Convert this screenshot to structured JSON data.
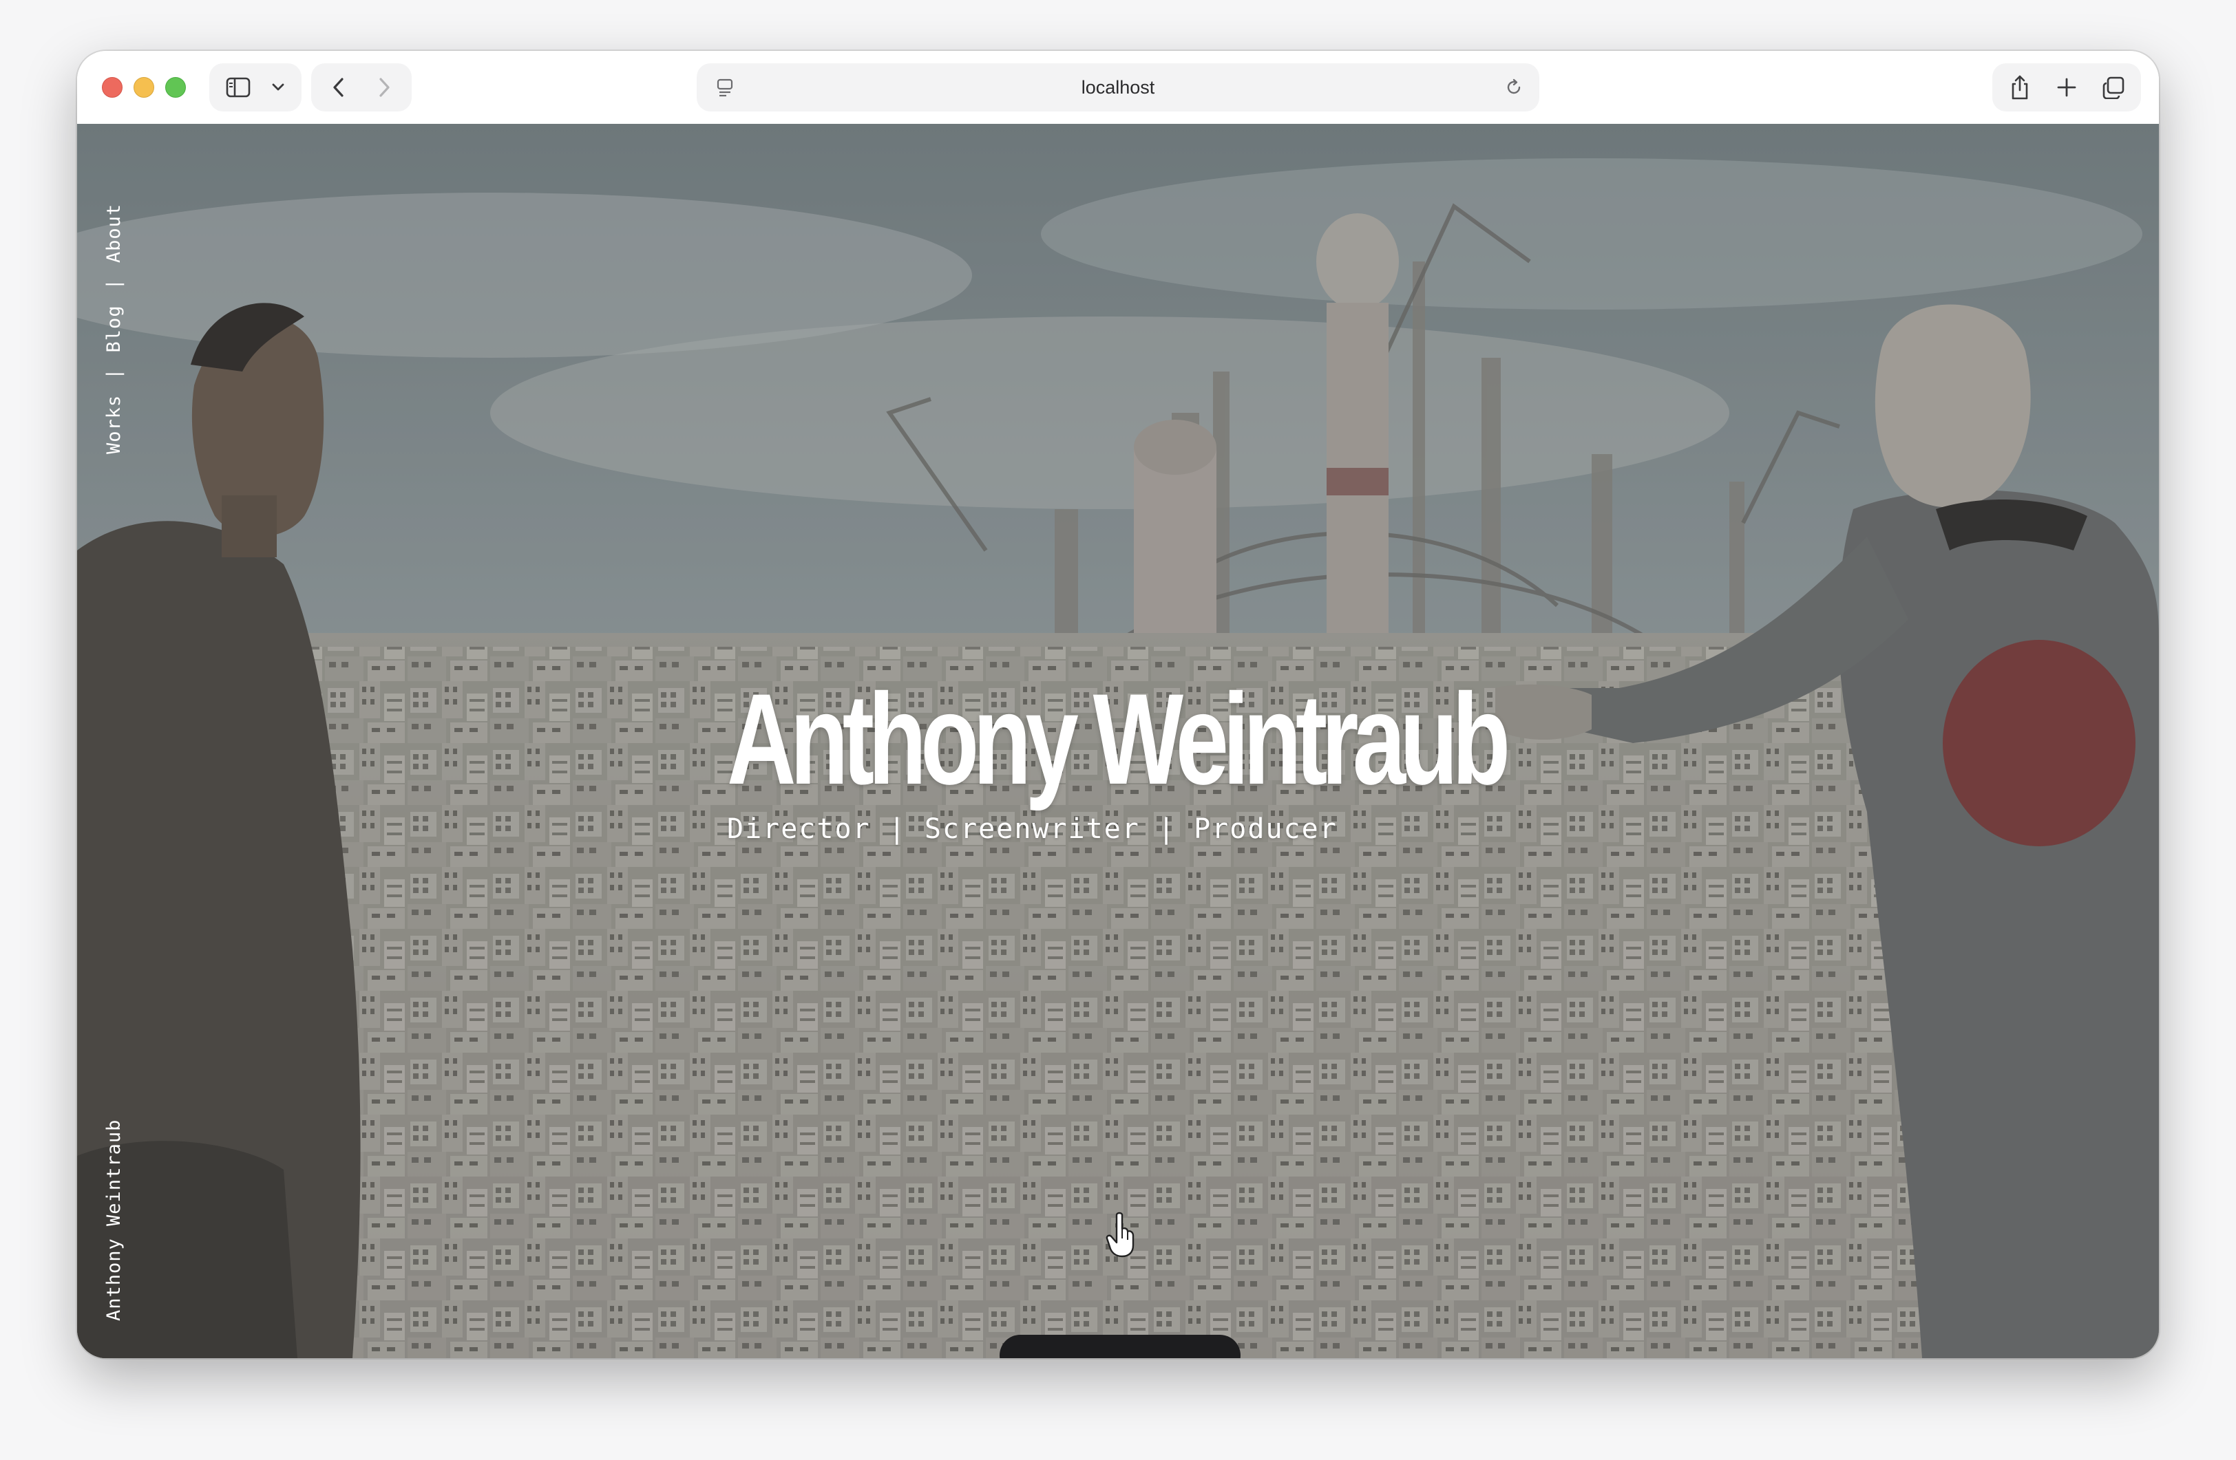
{
  "browser": {
    "url": "localhost",
    "icons": {
      "sidebar": "sidebar-icon",
      "chevron": "chevron-down-icon",
      "back": "back-icon",
      "forward": "forward-icon",
      "page": "page-icon",
      "reload": "reload-icon",
      "share": "share-icon",
      "new_tab": "plus-icon",
      "tabs": "tabs-overview-icon"
    }
  },
  "site": {
    "nav": {
      "works": "Works",
      "sep": "|",
      "blog": "Blog",
      "about": "About"
    },
    "footer_name": "Anthony Weintraub",
    "hero": {
      "title": "Anthony Weintraub",
      "subtitle": "Director | Screenwriter | Producer"
    }
  },
  "colors": {
    "accent_white": "#ffffff",
    "sky": "#8e9a9e",
    "city": "#b0aea8",
    "dark_jacket": "#4c4944",
    "coat": "#6e7172",
    "red_circle": "#7f3b3c"
  }
}
